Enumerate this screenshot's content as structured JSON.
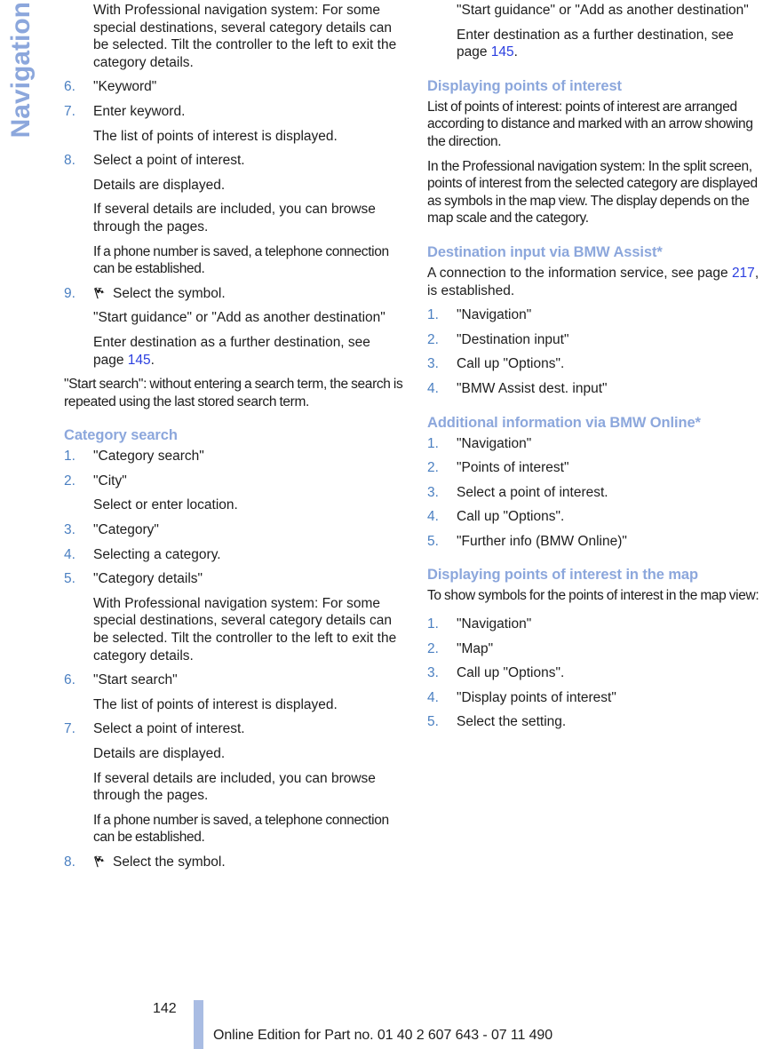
{
  "chapter": {
    "title": "Navigation"
  },
  "footer": {
    "page_number": "142",
    "edition_note": "Online Edition for Part no. 01 40 2 607 643 - 07 11 490",
    "bar_color": "#A9BCE3"
  },
  "colors": {
    "heading_blue": "#8CA7DC",
    "list_number_blue": "#4A7FC1",
    "page_reference_blue": "#2B3FE0",
    "body_text": "#1D1D1D"
  },
  "left_column": {
    "continued_paragraph": "With Professional navigation system: For some special destinations, several category details can be selected. Tilt the controller to the left to exit the category details.",
    "keyword_steps": [
      {
        "num": "6.",
        "text": "\"Keyword\"",
        "subs": []
      },
      {
        "num": "7.",
        "text": "Enter keyword.",
        "subs": [
          "The list of points of interest is displayed."
        ]
      },
      {
        "num": "8.",
        "text": "Select a point of interest.",
        "subs": [
          "Details are displayed.",
          "If several details are included, you can browse through the pages.",
          "If a phone number is saved, a telephone connection can be established."
        ]
      },
      {
        "num": "9.",
        "icon": "checkered-flag-icon",
        "text": "Select the symbol.",
        "subs": [
          "\"Start guidance\" or \"Add as another destination\"",
          "Enter destination as a further destination, see page 145."
        ],
        "sub_pageref": "145"
      }
    ],
    "start_search_note": "\"Start search\": without entering a search term, the search is repeated using the last stored search term.",
    "category_search": {
      "heading": "Category search",
      "steps": [
        {
          "num": "1.",
          "text": "\"Category search\"",
          "subs": []
        },
        {
          "num": "2.",
          "text": "\"City\"",
          "subs": [
            "Select or enter location."
          ]
        },
        {
          "num": "3.",
          "text": "\"Category\"",
          "subs": []
        },
        {
          "num": "4.",
          "text": "Selecting a category.",
          "subs": []
        },
        {
          "num": "5.",
          "text": "\"Category details\"",
          "subs": [
            "With Professional navigation system: For some special destinations, several category details can be selected. Tilt the controller to the left to exit the category details."
          ]
        },
        {
          "num": "6.",
          "text": "\"Start search\"",
          "subs": [
            "The list of points of interest is displayed."
          ]
        },
        {
          "num": "7.",
          "text": "Select a point of interest.",
          "subs": [
            "Details are displayed.",
            "If several details are included, you can browse through the pages.",
            "If a phone number is saved, a telephone connection can be established."
          ]
        },
        {
          "num": "8.",
          "icon": "checkered-flag-icon",
          "text": "Select the symbol.",
          "subs": []
        }
      ]
    }
  },
  "right_column": {
    "continued_subs": [
      "\"Start guidance\" or \"Add as another destination\"",
      "Enter destination as a further destination, see page 145."
    ],
    "continued_pageref": "145",
    "displaying_poi": {
      "heading": "Displaying points of interest",
      "paragraphs": [
        "List of points of interest: points of interest are arranged according to distance and marked with an arrow showing the direction.",
        "In the Professional navigation system: In the split screen, points of interest from the selected category are displayed as symbols in the map view. The display depends on the map scale and the category."
      ]
    },
    "bmw_assist": {
      "heading": "Destination input via BMW Assist*",
      "intro_before": "A connection to the information service, see page ",
      "intro_pageref": "217",
      "intro_after": ", is established.",
      "steps": [
        {
          "num": "1.",
          "text": "\"Navigation\""
        },
        {
          "num": "2.",
          "text": "\"Destination input\""
        },
        {
          "num": "3.",
          "text": "Call up \"Options\"."
        },
        {
          "num": "4.",
          "text": "\"BMW Assist dest. input\""
        }
      ]
    },
    "bmw_online": {
      "heading": "Additional information via BMW Online*",
      "steps": [
        {
          "num": "1.",
          "text": "\"Navigation\""
        },
        {
          "num": "2.",
          "text": "\"Points of interest\""
        },
        {
          "num": "3.",
          "text": "Select a point of interest."
        },
        {
          "num": "4.",
          "text": "Call up \"Options\"."
        },
        {
          "num": "5.",
          "text": "\"Further info (BMW Online)\""
        }
      ]
    },
    "poi_in_map": {
      "heading": "Displaying points of interest in the map",
      "intro": "To show symbols for the points of interest in the map view:",
      "steps": [
        {
          "num": "1.",
          "text": "\"Navigation\""
        },
        {
          "num": "2.",
          "text": "\"Map\""
        },
        {
          "num": "3.",
          "text": "Call up \"Options\"."
        },
        {
          "num": "4.",
          "text": "\"Display points of interest\""
        },
        {
          "num": "5.",
          "text": "Select the setting."
        }
      ]
    }
  }
}
